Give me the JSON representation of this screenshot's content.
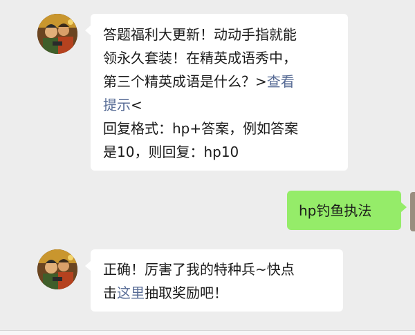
{
  "messages": [
    {
      "sender": "bot",
      "avatar_icon": "game-character-avatar",
      "lines": [
        {
          "text": "答题福利大更新！动动手指就能"
        },
        {
          "text": "领永久套装！在精英成语秀中，"
        },
        {
          "before": "第三个精英成语是什么？>",
          "link": "查看"
        },
        {
          "link": "提示",
          "after": "<"
        },
        {
          "text": "回复格式：hp+答案，例如答案"
        },
        {
          "text": "是10，则回复：hp10"
        }
      ]
    },
    {
      "sender": "user",
      "text": "hp钓鱼执法"
    },
    {
      "sender": "bot",
      "avatar_icon": "game-character-avatar",
      "lines": [
        {
          "text": "正确！厉害了我的特种兵~快点"
        },
        {
          "before": "击",
          "link": "这里",
          "after": "抽取奖励吧！"
        }
      ]
    }
  ],
  "colors": {
    "background": "#ededed",
    "incoming_bubble": "#ffffff",
    "outgoing_bubble": "#95ec69",
    "link": "#576b95"
  }
}
